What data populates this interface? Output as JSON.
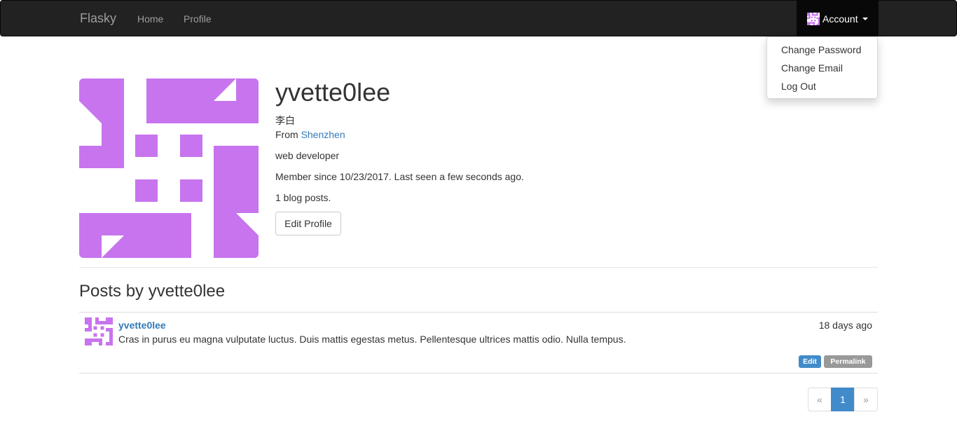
{
  "nav": {
    "brand": "Flasky",
    "home": "Home",
    "profile": "Profile",
    "account": "Account",
    "account_menu": [
      "Change Password",
      "Change Email",
      "Log Out"
    ]
  },
  "user": {
    "username": "yvette0lee",
    "name": "李白",
    "from_label": "From",
    "location": "Shenzhen",
    "about": "web developer",
    "member_line": "Member since 10/23/2017. Last seen a few seconds ago.",
    "posts_count": "1 blog posts.",
    "edit_button": "Edit Profile",
    "avatar_icon": "identicon-avatar",
    "avatar_color": "#c774ee"
  },
  "posts_section": {
    "title": "Posts by yvette0lee",
    "posts": [
      {
        "author": "yvette0lee",
        "date": "18 days ago",
        "body": "Cras in purus eu magna vulputate luctus. Duis mattis egestas metus. Pellentesque ultrices mattis odio. Nulla tempus.",
        "edit_label": "Edit",
        "permalink_label": "Permalink"
      }
    ]
  },
  "pagination": {
    "prev": "«",
    "current": "1",
    "next": "»"
  },
  "colors": {
    "navbar_bg": "#222222",
    "link": "#337ab7",
    "primary": "#428bca",
    "muted_label": "#999999"
  }
}
